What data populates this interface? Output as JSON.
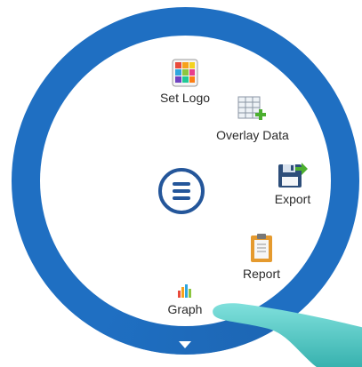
{
  "radial_menu": {
    "center_icon": "hamburger-menu-icon",
    "collapse_icon": "caret-down-icon",
    "items": [
      {
        "label": "Set Logo",
        "icon": "color-grid-icon"
      },
      {
        "label": "Overlay Data",
        "icon": "spreadsheet-plus-icon"
      },
      {
        "label": "Export",
        "icon": "floppy-disk-export-icon"
      },
      {
        "label": "Report",
        "icon": "clipboard-icon"
      },
      {
        "label": "Graph",
        "icon": "bar-chart-icon"
      }
    ]
  },
  "colors": {
    "ring": "#1f6fc2",
    "center_icon": "#24569a",
    "finger": "#3cc7c4"
  }
}
